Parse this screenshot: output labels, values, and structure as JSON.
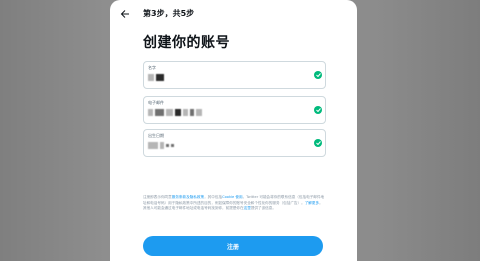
{
  "header": {
    "step": "第3步，共5步"
  },
  "form": {
    "title": "创建你的账号",
    "fields": [
      {
        "label": "名字",
        "valid": true
      },
      {
        "label": "电子邮件",
        "valid": true
      },
      {
        "label": "出生日期",
        "valid": true
      }
    ]
  },
  "legal": {
    "p1": "注册即表示你同意",
    "link_terms": "服务条款及隐私政策",
    "p2": "，其中包括",
    "link_cookie": "Cookie 使用",
    "p3": "。Twitter 可能会将你的联系信息（包括电子邮件地址和电话号码）用于隐私政策中所述的目的，例如保障你的账号安全和个性化你的服务（包括广告）。",
    "link_learn": "了解更多",
    "p4": "。其他人可能会通过电子邮件地址或电话号码找到你，前提是你在",
    "link_here": "这里",
    "p5": "提供了该信息。"
  },
  "actions": {
    "signup_label": "注册"
  },
  "colors": {
    "accent": "#1d9bf0",
    "valid": "#00ba7c"
  }
}
